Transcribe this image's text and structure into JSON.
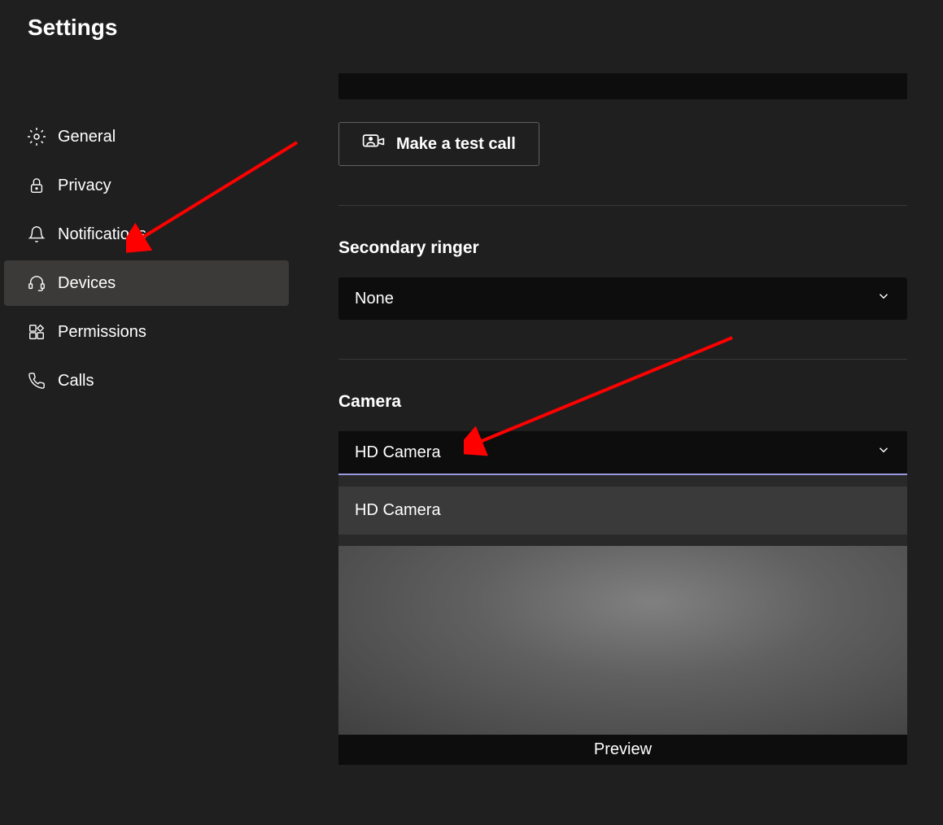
{
  "title": "Settings",
  "sidebar": {
    "items": [
      {
        "label": "General",
        "icon": "gear"
      },
      {
        "label": "Privacy",
        "icon": "lock"
      },
      {
        "label": "Notifications",
        "icon": "bell"
      },
      {
        "label": "Devices",
        "icon": "headset",
        "active": true
      },
      {
        "label": "Permissions",
        "icon": "apps"
      },
      {
        "label": "Calls",
        "icon": "phone"
      }
    ]
  },
  "content": {
    "testCallLabel": "Make a test call",
    "secondaryRinger": {
      "label": "Secondary ringer",
      "value": "None"
    },
    "camera": {
      "label": "Camera",
      "value": "HD Camera",
      "options": [
        "HD Camera"
      ],
      "previewLabel": "Preview"
    }
  }
}
